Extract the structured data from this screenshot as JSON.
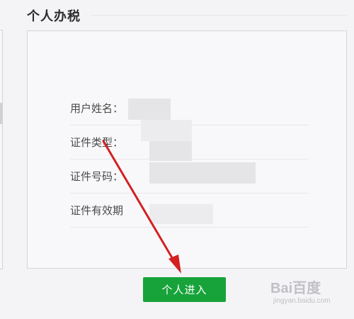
{
  "section": {
    "title": "个人办税"
  },
  "form": {
    "rows": [
      {
        "label": "用户姓名："
      },
      {
        "label": "证件类型："
      },
      {
        "label": "证件号码："
      },
      {
        "label": "证件有效期"
      }
    ]
  },
  "actions": {
    "enter_label": "个人进入"
  },
  "colors": {
    "button": "#17a33a",
    "annotation_arrow": "#d42020"
  },
  "watermark": {
    "logo": "Bai百度",
    "sub": "jingyan.baidu.com"
  }
}
